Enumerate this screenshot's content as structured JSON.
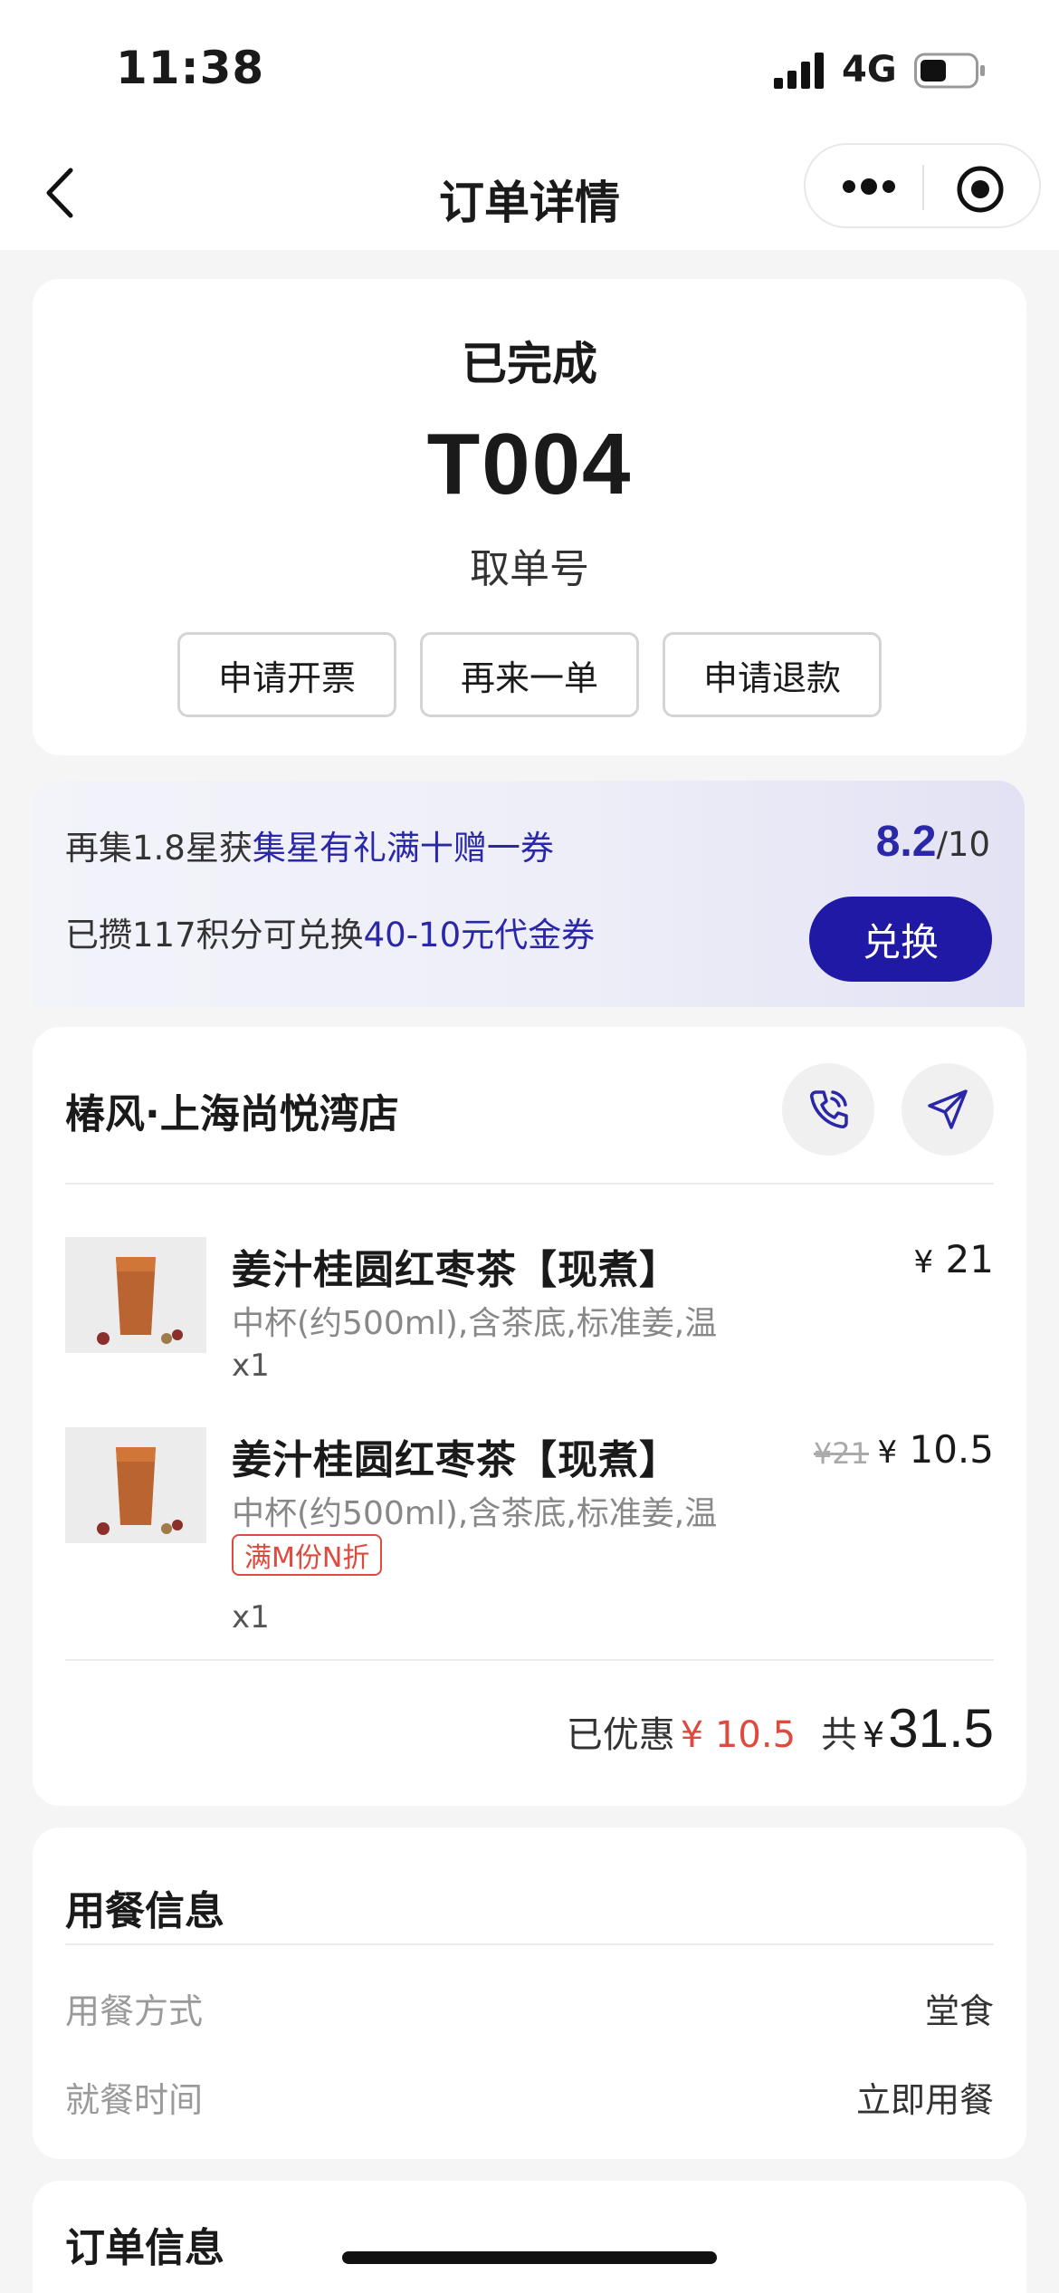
{
  "status_bar": {
    "time": "11:38",
    "network": "4G"
  },
  "nav": {
    "title": "订单详情"
  },
  "order": {
    "status": "已完成",
    "pickup_number": "T004",
    "pickup_label": "取单号",
    "actions": [
      "申请开票",
      "再来一单",
      "申请退款"
    ]
  },
  "loyalty": {
    "line1_prefix": "再集1.8星获",
    "line1_highlight": "集星有礼满十赠一券",
    "stars_current": "8.2",
    "stars_total": "/10",
    "line2_prefix": "已攒117积分可兑换",
    "line2_highlight": "40-10元代金券",
    "exchange_label": "兑换",
    "accent_color": "#2a27a8"
  },
  "store": {
    "name": "椿风·上海尚悦湾店",
    "items": [
      {
        "name": "姜汁桂圆红枣茶【现煮】",
        "spec": "中杯(约500ml),含茶底,标准姜,温",
        "qty": "x1",
        "currency": "¥",
        "price": "21"
      },
      {
        "name": "姜汁桂圆红枣茶【现煮】",
        "spec": "中杯(约500ml),含茶底,标准姜,温",
        "promo": "满M份N折",
        "qty": "x1",
        "original_price": "¥21",
        "currency": "¥",
        "price": "10.5"
      }
    ],
    "discount_label": "已优惠",
    "discount_amount": "¥ 10.5",
    "total_label": "共",
    "total_currency": "¥",
    "total_amount": "31.5",
    "discount_color": "#e0493e"
  },
  "dining": {
    "title": "用餐信息",
    "rows": [
      {
        "key": "用餐方式",
        "value": "堂食"
      },
      {
        "key": "就餐时间",
        "value": "立即用餐"
      }
    ]
  },
  "order_info": {
    "title": "订单信息"
  },
  "icons": {
    "back": "chevron-left-icon",
    "more": "more-dots-icon",
    "target": "target-icon",
    "phone": "phone-icon",
    "navigate": "navigation-arrow-icon"
  }
}
